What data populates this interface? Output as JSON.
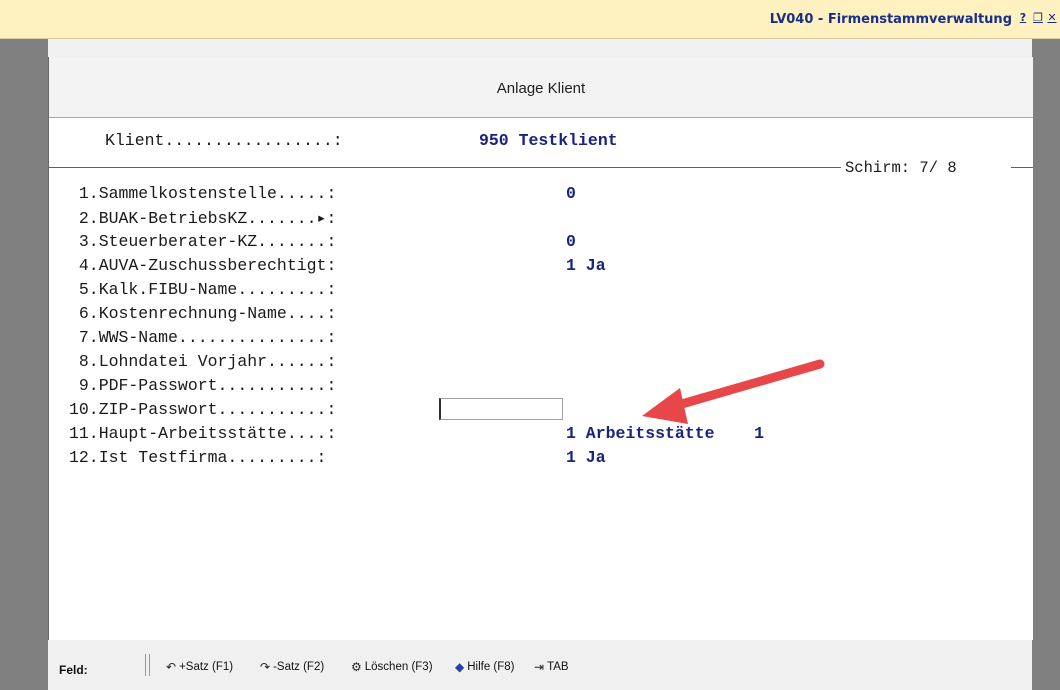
{
  "window": {
    "title": "LV040 - Firmenstammverwaltung",
    "help_btn": "?",
    "restore_btn": "❐",
    "close_btn": "✕"
  },
  "header": {
    "title": "Anlage Klient"
  },
  "client": {
    "label": "Klient.................:",
    "value": "950 Testklient"
  },
  "screen": {
    "label": "Schirm: 7/ 8"
  },
  "fields": [
    {
      "label": " 1.Sammelkostenstelle.....:",
      "value": "0"
    },
    {
      "label": " 2.BUAK-BetriebsKZ.......▸:",
      "value": ""
    },
    {
      "label": " 3.Steuerberater-KZ.......:",
      "value": "0"
    },
    {
      "label": " 4.AUVA-Zuschussberechtigt:",
      "value": "1 Ja"
    },
    {
      "label": " 5.Kalk.FIBU-Name.........:",
      "value": ""
    },
    {
      "label": " 6.Kostenrechnung-Name....:",
      "value": ""
    },
    {
      "label": " 7.WWS-Name...............:",
      "value": ""
    },
    {
      "label": " 8.Lohndatei Vorjahr......:",
      "value": ""
    },
    {
      "label": " 9.PDF-Passwort...........:",
      "value": ""
    },
    {
      "label": "10.ZIP-Passwort...........:",
      "value": ""
    },
    {
      "label": "11.Haupt-Arbeitsstätte....:",
      "value": "1 Arbeitsstätte    1"
    },
    {
      "label": "12.Ist Testfirma.........:",
      "value": "1 Ja"
    }
  ],
  "footer": {
    "field_label": "Feld:",
    "buttons": [
      {
        "icon": "↶",
        "label": "+Satz (F1)"
      },
      {
        "icon": "↷",
        "label": "-Satz (F2)"
      },
      {
        "icon": "⚙",
        "label": "Löschen (F3)"
      },
      {
        "icon": "◆",
        "label": "Hilfe (F8)"
      },
      {
        "icon": "⇥",
        "label": "TAB"
      }
    ]
  },
  "colors": {
    "title_bg": "#fff2c0",
    "accent_blue": "#1a237e",
    "arrow_red": "#e8474a"
  }
}
